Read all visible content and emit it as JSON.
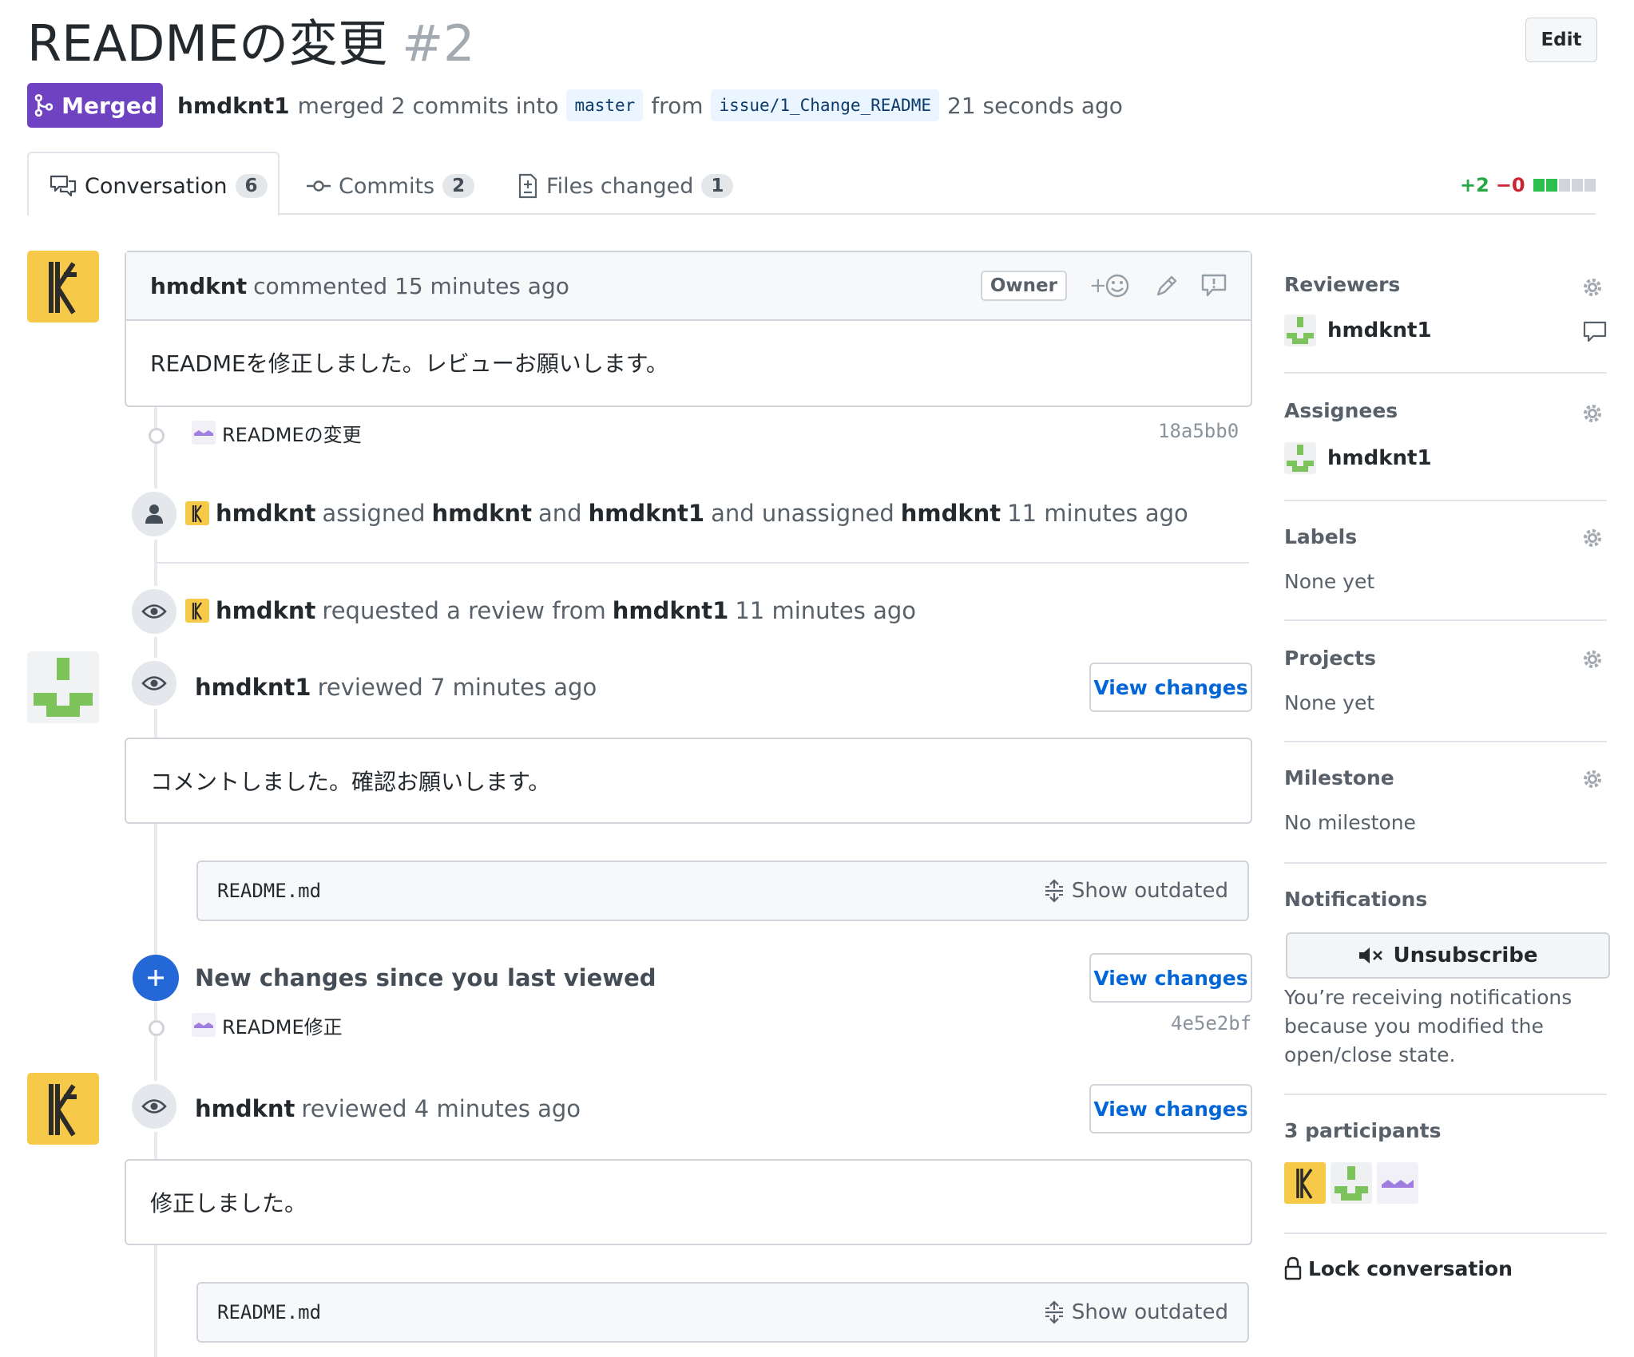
{
  "pr": {
    "title": "READMEの変更",
    "number": "#2",
    "edit_label": "Edit",
    "state": "Merged",
    "author": "hmdknt1",
    "merged_text": "merged 2 commits into",
    "base_branch": "master",
    "from_word": "from",
    "head_branch": "issue/1_Change_README",
    "time": "21 seconds ago"
  },
  "tabs": [
    {
      "label": "Conversation",
      "count": "6"
    },
    {
      "label": "Commits",
      "count": "2"
    },
    {
      "label": "Files changed",
      "count": "1"
    }
  ],
  "diffstat": {
    "additions": "+2",
    "deletions": "−0"
  },
  "timeline": {
    "comment1": {
      "author": "hmdknt",
      "action": "commented 15 minutes ago",
      "owner_label": "Owner",
      "body": "READMEを修正しました。レビューお願いします。"
    },
    "commit1": {
      "message": "READMEの変更",
      "sha": "18a5bb0"
    },
    "assign_event": {
      "actor": "hmdknt",
      "w1": "assigned",
      "u1": "hmdknt",
      "w2": "and",
      "u2": "hmdknt1",
      "w3": "and unassigned",
      "u3": "hmdknt",
      "time": "11 minutes ago"
    },
    "review_request": {
      "actor": "hmdknt",
      "text": "requested a review from",
      "target": "hmdknt1",
      "time": "11 minutes ago"
    },
    "review1": {
      "author": "hmdknt1",
      "action": "reviewed 7 minutes ago",
      "button": "View changes",
      "body": "コメントしました。確認お願いします。",
      "file": "README.md",
      "outdated": "Show outdated"
    },
    "new_changes": {
      "text": "New changes since you last viewed",
      "button": "View changes"
    },
    "commit2": {
      "message": "README修正",
      "sha": "4e5e2bf"
    },
    "review2": {
      "author": "hmdknt",
      "action": "reviewed 4 minutes ago",
      "button": "View changes",
      "body": "修正しました。",
      "file": "README.md",
      "outdated": "Show outdated"
    }
  },
  "sidebar": {
    "reviewers": {
      "title": "Reviewers",
      "user": "hmdknt1"
    },
    "assignees": {
      "title": "Assignees",
      "user": "hmdknt1"
    },
    "labels": {
      "title": "Labels",
      "value": "None yet"
    },
    "projects": {
      "title": "Projects",
      "value": "None yet"
    },
    "milestone": {
      "title": "Milestone",
      "value": "No milestone"
    },
    "notifications": {
      "title": "Notifications",
      "button": "Unsubscribe",
      "line1": "You’re receiving notifications",
      "line2": "because you modified the",
      "line3": "open/close state."
    },
    "participants": {
      "title": "3 participants"
    },
    "lock": "Lock conversation"
  },
  "colors": {
    "merged": "#6f42c1",
    "link": "#0366d6",
    "add": "#28a745",
    "del": "#cb2431",
    "avatar_yellow": "#f7c948",
    "avatar_green": "#7cc35c",
    "avatar_purple": "#a07ee0"
  }
}
